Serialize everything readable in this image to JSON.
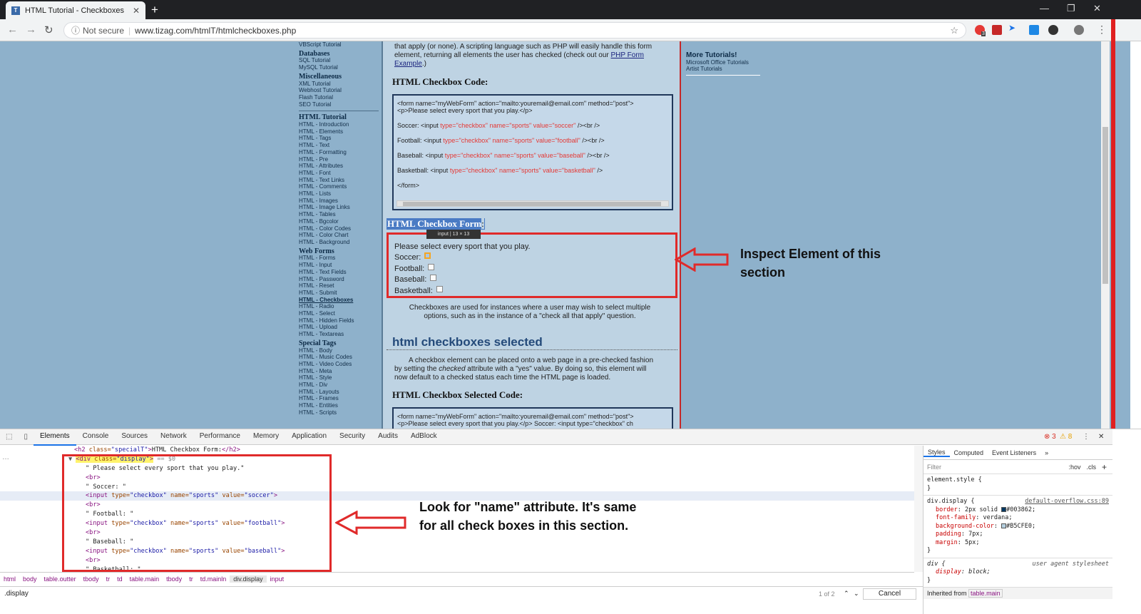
{
  "browser": {
    "tab_title": "HTML Tutorial - Checkboxes",
    "tab_favicon": "T",
    "new_tab": "+",
    "security": "Not secure",
    "url": "www.tizag.com/htmlT/htmlcheckboxes.php",
    "ext_badge": "3"
  },
  "sidenav": {
    "top_link": "VBScript Tutorial",
    "groups": [
      {
        "title": "Databases",
        "items": [
          "SQL Tutorial",
          "MySQL Tutorial"
        ]
      },
      {
        "title": "Miscellaneous",
        "items": [
          "XML Tutorial",
          "Webhost Tutorial",
          "Flash Tutorial",
          "SEO Tutorial"
        ]
      },
      {
        "title": "HTML Tutorial",
        "items": [
          "HTML - Introduction",
          "HTML - Elements",
          "HTML - Tags",
          "HTML - Text",
          "HTML - Formatting",
          "HTML - Pre",
          "HTML - Attributes",
          "HTML - Font",
          "HTML - Text Links",
          "HTML - Comments",
          "HTML - Lists",
          "HTML - Images",
          "HTML - Image Links",
          "HTML - Tables",
          "HTML - Bgcolor",
          "HTML - Color Codes",
          "HTML - Color Chart",
          "HTML - Background"
        ]
      },
      {
        "title": "Web Forms",
        "items": [
          "HTML - Forms",
          "HTML - Input",
          "HTML - Text Fields",
          "HTML - Password",
          "HTML - Reset",
          "HTML - Submit",
          "HTML - Checkboxes",
          "HTML - Radio",
          "HTML - Select",
          "HTML - Hidden Fields",
          "HTML - Upload",
          "HTML - Textareas"
        ]
      },
      {
        "title": "Special Tags",
        "items": [
          "HTML - Body",
          "HTML - Music Codes",
          "HTML - Video Codes",
          "HTML - Meta",
          "HTML - Style",
          "HTML - Div",
          "HTML - Layouts",
          "HTML - Frames",
          "HTML - Entities",
          "HTML - Scripts"
        ]
      }
    ],
    "active_item": "HTML - Checkboxes"
  },
  "main": {
    "intro_lines": [
      "that apply (or none). A scripting language such as PHP will easily handle this form",
      "element, returning all elements the user has checked (check out our ",
      "PHP Form",
      "Example",
      ".)"
    ],
    "code_heading": "HTML Checkbox Code:",
    "code": {
      "form_line1": "<form name=\"myWebForm\" action=\"mailto:youremail@email.com\" method=\"post\">",
      "form_line2": "<p>Please select every sport that you play.</p>",
      "rows": [
        {
          "label": "Soccer: <input ",
          "attrs": "type=\"checkbox\" name=\"sports\" value=\"soccer\"",
          "end": " /><br />"
        },
        {
          "label": "Football: <input ",
          "attrs": "type=\"checkbox\" name=\"sports\" value=\"football\"",
          "end": " /><br />"
        },
        {
          "label": "Baseball: <input ",
          "attrs": "type=\"checkbox\" name=\"sports\" value=\"baseball\"",
          "end": " /><br />"
        },
        {
          "label": "Basketball: <input ",
          "attrs": "type=\"checkbox\" name=\"sports\" value=\"basketball\"",
          "end": " />"
        }
      ],
      "close": "</form>"
    },
    "form_heading": "HTML Checkbox Form",
    "form_heading_colon": ":",
    "tooltip": "input | 13 × 13",
    "form_prompt": "Please select every sport that you play.",
    "sports": [
      "Soccer:",
      "Football:",
      "Baseball:",
      "Basketball:"
    ],
    "para1": [
      "Checkboxes are used for instances where a user may wish to select multiple",
      "options, such as in the instance of a \"check all that apply\" question."
    ],
    "selected_heading": "html checkboxes selected",
    "para2_a": "A checkbox element can be placed onto a web page in a pre-checked fashion",
    "para2_b": "by setting the ",
    "para2_b_em": "checked",
    "para2_b_end": " attribute with a \"yes\" value. By doing so, this element will",
    "para2_c": "now default to a checked status each time the HTML page is loaded.",
    "selected_code_heading": "HTML Checkbox Selected Code:",
    "sel_code1": "<form name=\"myWebForm\" action=\"mailto:youremail@email.com\" method=\"post\">",
    "sel_code2": "<p>Please select every sport that you play.</p> Soccer: <input type=\"checkbox\" ch"
  },
  "rightcol": {
    "title": "More Tutorials!",
    "items": [
      "Microsoft Office Tutorials",
      "Artist Tutorials"
    ]
  },
  "annotations": {
    "page": [
      "Inspect Element of this",
      "section"
    ],
    "dom": [
      "Look for \"name\" attribute. It's same",
      "for all check boxes in this section."
    ]
  },
  "devtools": {
    "tabs": [
      "Elements",
      "Console",
      "Sources",
      "Network",
      "Performance",
      "Memory",
      "Application",
      "Security",
      "Audits",
      "AdBlock"
    ],
    "errors": "3",
    "warnings": "8",
    "dom_lines": [
      {
        "indent": 13,
        "html": "h2",
        "text": "<h2 class=\"specialT\">HTML Checkbox Form:</h2>"
      },
      {
        "indent": 12,
        "text": "<div class=\"display\"> == $0"
      },
      {
        "indent": 15,
        "text": "\" Please select every sport that you play.\""
      },
      {
        "indent": 15,
        "text": "<br>"
      },
      {
        "indent": 15,
        "text": "\" Soccer: \""
      },
      {
        "indent": 15,
        "text": "<input type=\"checkbox\" name=\"sports\" value=\"soccer\">"
      },
      {
        "indent": 15,
        "text": "<br>"
      },
      {
        "indent": 15,
        "text": "\" Football: \""
      },
      {
        "indent": 15,
        "text": "<input type=\"checkbox\" name=\"sports\" value=\"football\">"
      },
      {
        "indent": 15,
        "text": "<br>"
      },
      {
        "indent": 15,
        "text": "\" Baseball: \""
      },
      {
        "indent": 15,
        "text": "<input type=\"checkbox\" name=\"sports\" value=\"baseball\">"
      },
      {
        "indent": 15,
        "text": "<br>"
      },
      {
        "indent": 15,
        "text": "\" Basketball: \""
      }
    ],
    "breadcrumbs": [
      "html",
      "body",
      "table.outter",
      "tbody",
      "tr",
      "td",
      "table.main",
      "tbody",
      "tr",
      "td.mainln",
      "div.display",
      "input"
    ],
    "search_query": ".display",
    "search_count": "1 of 2",
    "cancel": "Cancel",
    "styles_tabs": [
      "Styles",
      "Computed",
      "Event Listeners"
    ],
    "filter_placeholder": "Filter",
    "filter_hov": ":hov",
    "filter_cls": ".cls",
    "rule1_sel": "element.style {",
    "rule2_sel": "div.display {",
    "rule2_src": "default-overflow.css:89",
    "rule2_props": [
      {
        "p": "border",
        "v": "2px solid ",
        "sw": "#003862",
        "v2": "#003862;"
      },
      {
        "p": "font-family",
        "v": "verdana;"
      },
      {
        "p": "background-color",
        "v": "",
        "sw": "#B5CFE0",
        "v2": "#B5CFE0;"
      },
      {
        "p": "padding",
        "v": "7px;"
      },
      {
        "p": "margin",
        "v": "5px;"
      }
    ],
    "rule3_sel": "div {",
    "rule3_src": "user agent stylesheet",
    "rule3_prop": "display",
    "rule3_val": "block;",
    "inherited_label": "Inherited from",
    "inherited_from": "table.main"
  }
}
